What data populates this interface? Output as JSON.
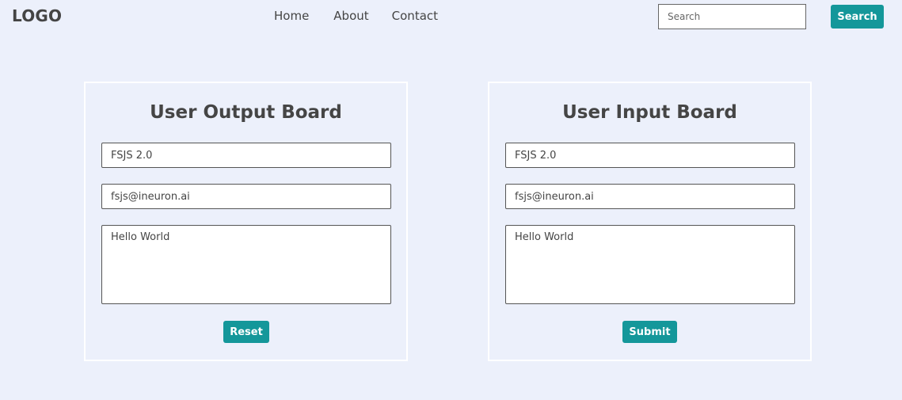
{
  "nav": {
    "logo": "LOGO",
    "links": [
      "Home",
      "About",
      "Contact"
    ],
    "search_placeholder": "Search",
    "search_button": "Search"
  },
  "output_board": {
    "title": "User Output Board",
    "name_value": "FSJS 2.0",
    "email_value": "fsjs@ineuron.ai",
    "message_value": "Hello World",
    "button_label": "Reset"
  },
  "input_board": {
    "title": "User Input Board",
    "name_value": "FSJS 2.0",
    "email_value": "fsjs@ineuron.ai",
    "message_value": "Hello World",
    "button_label": "Submit"
  },
  "colors": {
    "page_background": "#ecf0fb",
    "accent": "#14979a",
    "text": "#444444"
  }
}
